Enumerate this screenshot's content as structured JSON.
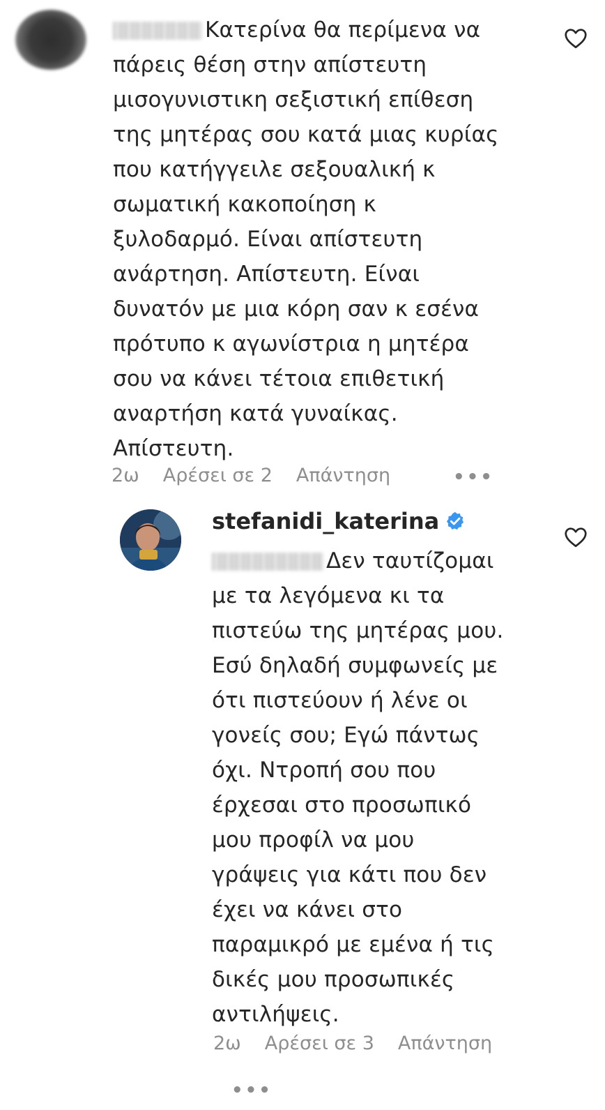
{
  "comment1": {
    "username_visible": "",
    "lines": [
      "Κατερίνα θα περίμενα να",
      "πάρεις θέση στην απίστευτη",
      "μισογυνιστικη σεξιστική επίθεση",
      "της μητέρας σου κατά μιας κυρίας",
      "που κατήγγειλε σεξουαλική κ",
      "σωματική κακοποίηση κ",
      "ξυλοδαρμό. Είναι απίστευτη",
      "ανάρτηση. Απίστευτη. Είναι",
      "δυνατόν με μια κόρη σαν κ εσένα",
      "πρότυπο κ αγωνίστρια η μητέρα",
      "σου να κάνει τέτοια επιθετική",
      "αναρτήση κατά γυναίκας.",
      "Απίστευτη."
    ],
    "time": "2ω",
    "likes": "Αρέσει σε 2",
    "reply": "Απάντηση",
    "more": "•••"
  },
  "comment2": {
    "username": "stefanidi_katerina",
    "lines": [
      "Δεν ταυτίζομαι",
      "με τα λεγόμενα κι τα",
      "πιστεύω της μητέρας μου.",
      "Εσύ δηλαδή συμφωνείς με",
      "ότι πιστεύουν ή λένε οι",
      "γονείς σου; Εγώ πάντως",
      "όχι. Ντροπή σου που",
      "έρχεσαι στο προσωπικό",
      "μου προφίλ να μου",
      "γράψεις για κάτι που δεν",
      "έχει να κάνει στο",
      "παραμικρό με εμένα ή τις",
      "δικές μου προσωπικές",
      "αντιλήψεις."
    ],
    "time": "2ω",
    "likes": "Αρέσει σε 3",
    "reply": "Απάντηση",
    "more": "•••"
  },
  "icons": {
    "heart": "heart-outline-icon",
    "verified": "verified-badge-icon",
    "verified_color": "#3897f0"
  }
}
